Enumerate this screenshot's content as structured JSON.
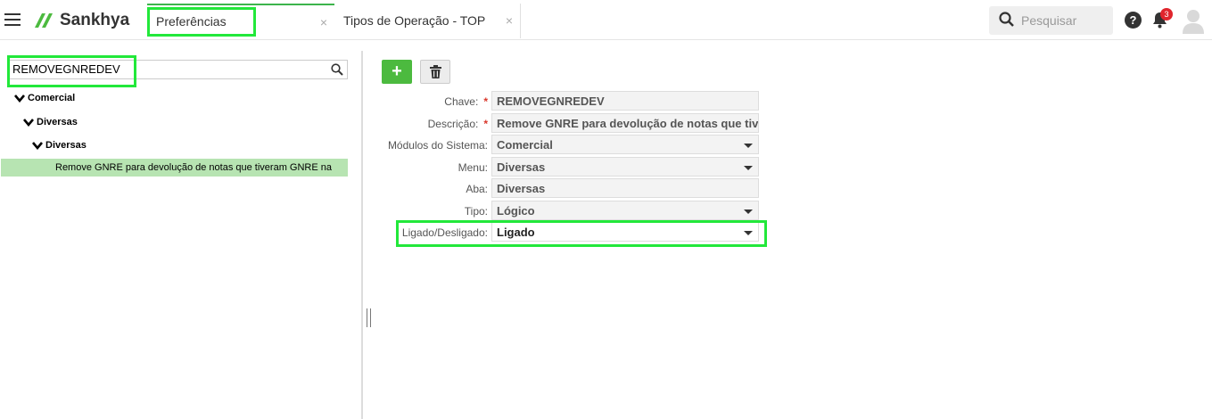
{
  "app": {
    "logo_text": "Sankhya"
  },
  "tabs": [
    {
      "label": "Preferências"
    },
    {
      "label": "Tipos de Operação - TOP"
    }
  ],
  "tab_close_glyph": "×",
  "header": {
    "search_placeholder": "Pesquisar",
    "help_glyph": "?",
    "notification_count": "3"
  },
  "left_panel": {
    "search_value": "REMOVEGNREDEV",
    "tree": [
      {
        "label": "Comercial",
        "level": 0
      },
      {
        "label": "Diversas",
        "level": 1
      },
      {
        "label": "Diversas",
        "level": 2
      }
    ],
    "selected_item": "Remove GNRE para devolução de notas que tiveram GNRE na"
  },
  "toolbar": {
    "add_glyph": "+"
  },
  "form": {
    "fields": [
      {
        "label": "Chave:",
        "value": "REMOVEGNREDEV",
        "required": true,
        "dropdown": false
      },
      {
        "label": "Descrição:",
        "value": "Remove GNRE para devolução de notas que tiveram GNRE na",
        "required": true,
        "dropdown": false
      },
      {
        "label": "Módulos do Sistema:",
        "value": "Comercial",
        "required": false,
        "dropdown": true
      },
      {
        "label": "Menu:",
        "value": "Diversas",
        "required": false,
        "dropdown": true
      },
      {
        "label": "Aba:",
        "value": "Diversas",
        "required": false,
        "dropdown": false
      },
      {
        "label": "Tipo:",
        "value": "Lógico",
        "required": false,
        "dropdown": true
      },
      {
        "label": "Ligado/Desligado:",
        "value": "Ligado",
        "required": false,
        "dropdown": true
      }
    ],
    "required_marker": "*"
  },
  "colors": {
    "accent_green": "#4cba3f",
    "selected_row": "#b7e4b2",
    "highlight_box": "#22e83a",
    "badge_red": "#e0252d"
  },
  "icons": [
    "menu-icon",
    "sankhya-logo-icon",
    "close-icon",
    "search-icon",
    "help-icon",
    "bell-icon",
    "avatar-icon",
    "chevron-down-icon",
    "plus-icon",
    "trash-icon",
    "dropdown-caret-icon"
  ]
}
